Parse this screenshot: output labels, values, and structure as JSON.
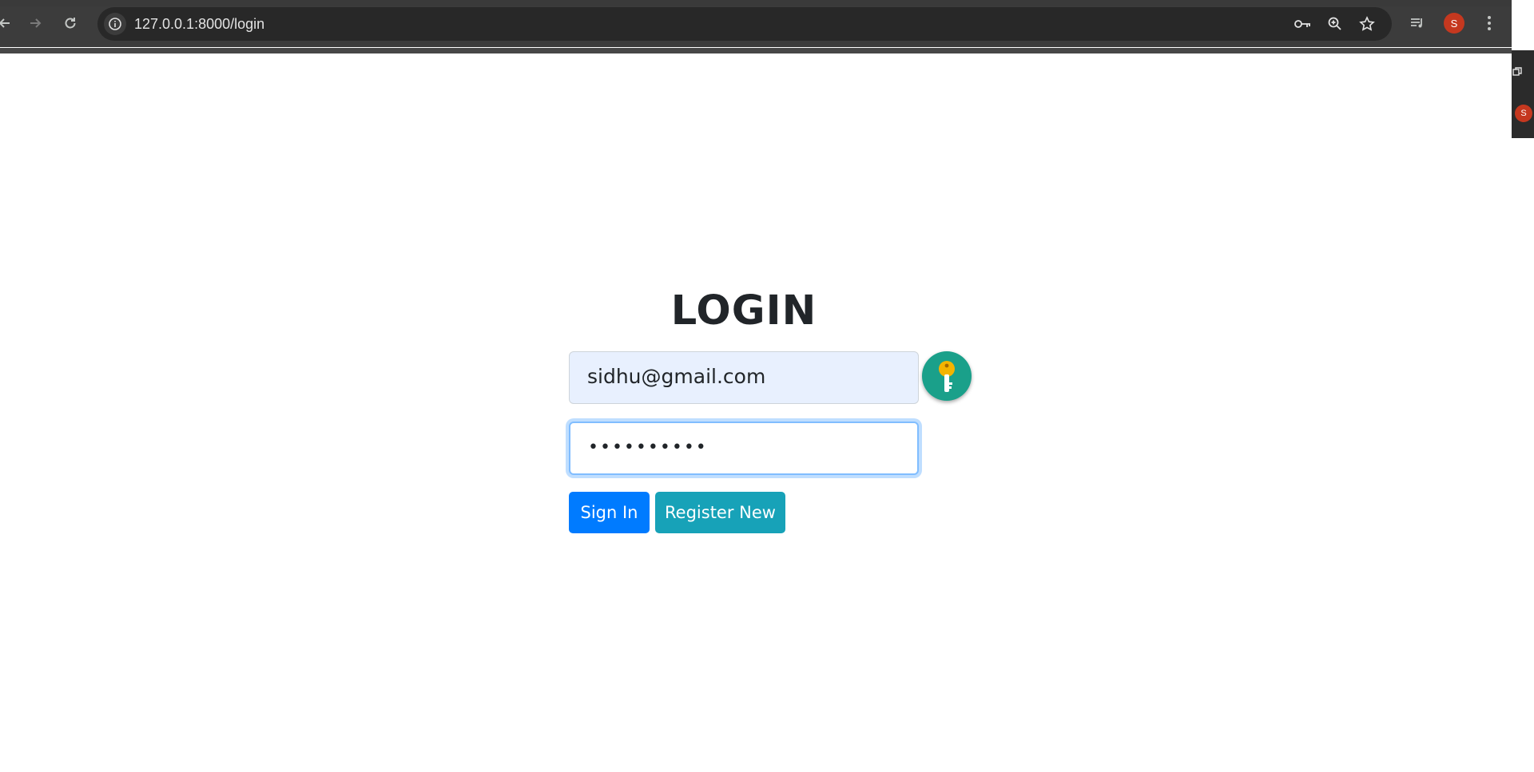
{
  "browser": {
    "url": "127.0.0.1:8000/login",
    "profile_initial": "S",
    "icons": {
      "back": "back-arrow-icon",
      "forward": "forward-arrow-icon",
      "reload": "reload-icon",
      "site_info": "info-icon",
      "password": "key-icon",
      "zoom": "zoom-icon",
      "bookmark": "star-icon",
      "media": "media-queue-icon",
      "menu": "kebab-menu-icon"
    },
    "colors": {
      "toolbar": "#3c3c3c",
      "omnibox": "#282828",
      "avatar": "#c5381f"
    }
  },
  "side_panel": {
    "avatar_initial": "S"
  },
  "login": {
    "title": "LOGIN",
    "email_value": "sidhu@gmail.com",
    "password_masked": "••••••••••",
    "sign_in_label": "Sign In",
    "register_label": "Register New",
    "colors": {
      "sign_in": "#007bff",
      "register": "#17a2b8",
      "autofill_bg": "#e8f0fe",
      "key_badge": "#1aa08a"
    }
  }
}
